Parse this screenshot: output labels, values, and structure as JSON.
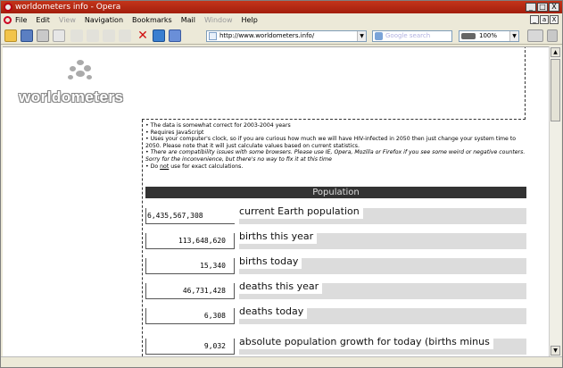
{
  "window": {
    "title": "worldometers info - Opera",
    "controls": [
      "_",
      "□",
      "X"
    ]
  },
  "menu": {
    "items": [
      "File",
      "Edit",
      "View",
      "Navigation",
      "Bookmarks",
      "Mail",
      "Window",
      "Help"
    ],
    "mdi_controls": [
      "_",
      "a",
      "X"
    ]
  },
  "toolbar": {
    "address": "http://www.worldometers.info/",
    "search_placeholder": "Google search",
    "zoom": "100%"
  },
  "page": {
    "logo_text": "worldometers",
    "notes": [
      "• The data is somewhat correct for 2003-2004 years",
      "• Requires JavaScript",
      "• Uses your computer's clock, so if you are curious how much we will have HIV-infected in 2050 then just change your system time to 2050. Please note that it will just calculate values based on current statistics.",
      "• There are compatibility issues with some browsers. Please use IE, Opera, Mozilla or Firefox if you see some weird or negative counters. Sorry for the inconvenience, but there's no way to fix it at this time",
      "• Do ",
      "not",
      " use for exact calculations."
    ],
    "section_title": "Population",
    "rows": [
      {
        "value": "6,435,567,308",
        "label": "current Earth population"
      },
      {
        "value": "113,648,620",
        "label": "births this year"
      },
      {
        "value": "15,340",
        "label": "births today"
      },
      {
        "value": "46,731,428",
        "label": "deaths this year"
      },
      {
        "value": "6,308",
        "label": "deaths today"
      },
      {
        "value": "9,032",
        "label": "absolute population growth for today (births minus"
      }
    ]
  },
  "colors": {
    "titlebar": "#b52815",
    "section_bar": "#333333",
    "row_bar": "#dcdcdc"
  }
}
